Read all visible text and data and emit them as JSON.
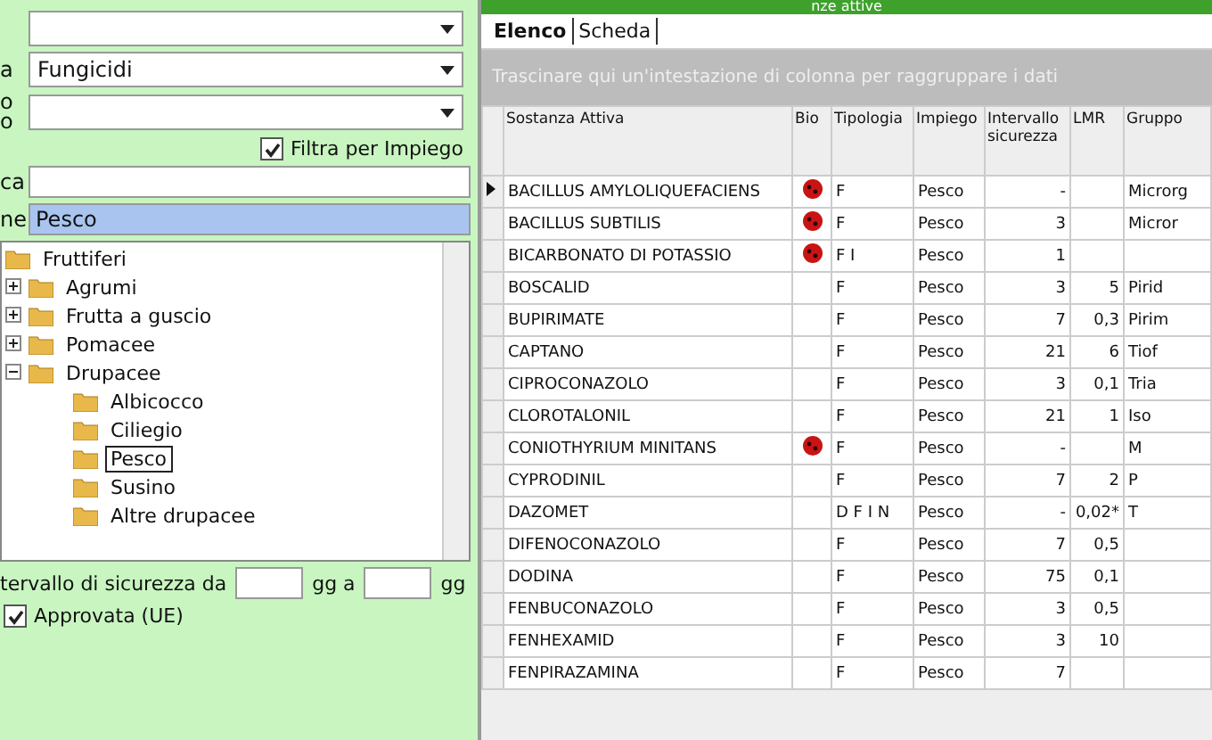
{
  "window": {
    "title": "nze attive"
  },
  "filters": {
    "fields": [
      {
        "kind": "dropdown"
      },
      {
        "kind": "dropdown",
        "label": [
          "a"
        ],
        "value": "Fungicidi"
      },
      {
        "kind": "dropdown",
        "label": [
          "o",
          "o"
        ]
      }
    ],
    "filter_by_use": {
      "label": "Filtra per Impiego",
      "checked": true
    },
    "search": {
      "label": "ca"
    },
    "selection": {
      "label": "ne",
      "value": "Pesco"
    }
  },
  "tree": [
    {
      "label": "Fruttiferi",
      "selected": false,
      "children": [
        {
          "label": "Agrumi",
          "expanded": false,
          "selected": false
        },
        {
          "label": "Frutta a guscio",
          "expanded": false,
          "selected": false
        },
        {
          "label": "Pomacee",
          "expanded": false,
          "selected": false
        },
        {
          "label": "Drupacee",
          "expanded": true,
          "selected": false,
          "children": [
            {
              "label": "Albicocco",
              "selected": false
            },
            {
              "label": "Ciliegio",
              "selected": false
            },
            {
              "label": "Pesco",
              "selected": true
            },
            {
              "label": "Susino",
              "selected": false
            },
            {
              "label": "Altre drupacee",
              "selected": false
            }
          ]
        }
      ]
    }
  ],
  "interval": {
    "label": "tervallo di sicurezza da",
    "middle": "gg a",
    "unit": "gg"
  },
  "approved": {
    "label": "Approvata (UE)",
    "checked": true
  },
  "tabs": [
    {
      "label": "Elenco",
      "selected": true
    },
    {
      "label": "Scheda",
      "selected": false
    }
  ],
  "group_hint": "Trascinare qui un'intestazione di colonna per raggruppare i dati",
  "table": {
    "columns": [
      "Sostanza Attiva",
      "Bio",
      "Tipologia",
      "Impiego",
      "Intervallo sicurezza",
      "LMR",
      "Gruppo"
    ],
    "rows": [
      {
        "current": true,
        "name": "BACILLUS AMYLOLIQUEFACIENS",
        "bio": true,
        "type": "F",
        "use": "Pesco",
        "interval": "-",
        "lmr": "",
        "group": "Microrg"
      },
      {
        "current": false,
        "name": "BACILLUS SUBTILIS",
        "bio": true,
        "type": "F",
        "use": "Pesco",
        "interval": "3",
        "lmr": "",
        "group": "Micror"
      },
      {
        "current": false,
        "name": "BICARBONATO DI POTASSIO",
        "bio": true,
        "type": "F I",
        "use": "Pesco",
        "interval": "1",
        "lmr": "",
        "group": ""
      },
      {
        "current": false,
        "name": "BOSCALID",
        "bio": false,
        "type": "F",
        "use": "Pesco",
        "interval": "3",
        "lmr": "5",
        "group": "Pirid"
      },
      {
        "current": false,
        "name": "BUPIRIMATE",
        "bio": false,
        "type": "F",
        "use": "Pesco",
        "interval": "7",
        "lmr": "0,3",
        "group": "Pirim"
      },
      {
        "current": false,
        "name": "CAPTANO",
        "bio": false,
        "type": "F",
        "use": "Pesco",
        "interval": "21",
        "lmr": "6",
        "group": "Tiof"
      },
      {
        "current": false,
        "name": "CIPROCONAZOLO",
        "bio": false,
        "type": "F",
        "use": "Pesco",
        "interval": "3",
        "lmr": "0,1",
        "group": "Tria"
      },
      {
        "current": false,
        "name": "CLOROTALONIL",
        "bio": false,
        "type": "F",
        "use": "Pesco",
        "interval": "21",
        "lmr": "1",
        "group": "Iso"
      },
      {
        "current": false,
        "name": "CONIOTHYRIUM MINITANS",
        "bio": true,
        "type": "F",
        "use": "Pesco",
        "interval": "-",
        "lmr": "",
        "group": "M"
      },
      {
        "current": false,
        "name": "CYPRODINIL",
        "bio": false,
        "type": "F",
        "use": "Pesco",
        "interval": "7",
        "lmr": "2",
        "group": "P"
      },
      {
        "current": false,
        "name": "DAZOMET",
        "bio": false,
        "type": "D F I N",
        "use": "Pesco",
        "interval": "-",
        "lmr": "0,02*",
        "group": "T"
      },
      {
        "current": false,
        "name": "DIFENOCONAZOLO",
        "bio": false,
        "type": "F",
        "use": "Pesco",
        "interval": "7",
        "lmr": "0,5",
        "group": ""
      },
      {
        "current": false,
        "name": "DODINA",
        "bio": false,
        "type": "F",
        "use": "Pesco",
        "interval": "75",
        "lmr": "0,1",
        "group": ""
      },
      {
        "current": false,
        "name": "FENBUCONAZOLO",
        "bio": false,
        "type": "F",
        "use": "Pesco",
        "interval": "3",
        "lmr": "0,5",
        "group": ""
      },
      {
        "current": false,
        "name": "FENHEXAMID",
        "bio": false,
        "type": "F",
        "use": "Pesco",
        "interval": "3",
        "lmr": "10",
        "group": ""
      },
      {
        "current": false,
        "name": "FENPIRAZAMINA",
        "bio": false,
        "type": "F",
        "use": "Pesco",
        "interval": "7",
        "lmr": "",
        "group": ""
      }
    ]
  }
}
